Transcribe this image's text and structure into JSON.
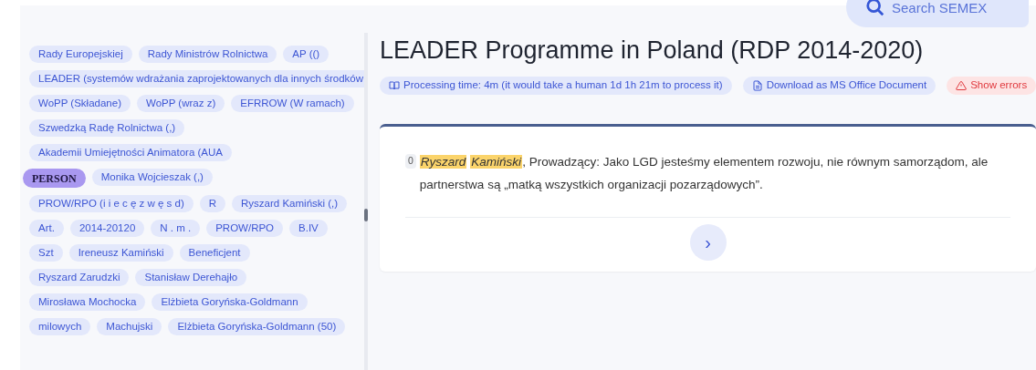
{
  "search": {
    "placeholder": "Search SEMEX"
  },
  "tag_rows": [
    [
      {
        "kind": "tag",
        "text": "Rady Europejskiej"
      },
      {
        "kind": "tag",
        "text": "Rady Ministrów Rolnictwa"
      },
      {
        "kind": "tag",
        "text": "AP (()"
      }
    ],
    [
      {
        "kind": "tag",
        "text": "LEADER (systemów wdrażania zaprojektowanych dla innych środków"
      }
    ],
    [
      {
        "kind": "tag",
        "text": "WoPP (Składane)"
      },
      {
        "kind": "tag",
        "text": "WoPP (wraz z)"
      },
      {
        "kind": "tag",
        "text": "EFRROW (W ramach)"
      }
    ],
    [
      {
        "kind": "tag",
        "text": "Szwedzką Radę Rolnictwa (,)"
      }
    ],
    [
      {
        "kind": "tag",
        "text": "Akademii Umiejętności Animatora (AUA"
      }
    ],
    [
      {
        "kind": "label",
        "text": "PERSON"
      },
      {
        "kind": "tag",
        "text": "Monika Wojcieszak (,)"
      }
    ],
    [
      {
        "kind": "tag",
        "text": "PROW/RPO (i i e c ę z w ę s d)"
      },
      {
        "kind": "tag",
        "text": "R"
      },
      {
        "kind": "tag",
        "text": "Ryszard Kamiński (,)"
      }
    ],
    [
      {
        "kind": "tag",
        "text": "Art."
      },
      {
        "kind": "tag",
        "text": "2014-20120"
      },
      {
        "kind": "tag",
        "text": "N . m ."
      },
      {
        "kind": "tag",
        "text": "PROW/RPO"
      },
      {
        "kind": "tag",
        "text": "B.IV"
      }
    ],
    [
      {
        "kind": "tag",
        "text": "Szt"
      },
      {
        "kind": "tag",
        "text": "Ireneusz Kamiński"
      },
      {
        "kind": "tag",
        "text": "Beneficjent"
      }
    ],
    [
      {
        "kind": "tag",
        "text": "Ryszard Zarudzki"
      },
      {
        "kind": "tag",
        "text": "Stanisław Derehajło"
      }
    ],
    [
      {
        "kind": "tag",
        "text": "Mirosława Mochocka"
      },
      {
        "kind": "tag",
        "text": "Elżbieta Goryńska-Goldmann"
      }
    ],
    [
      {
        "kind": "tag",
        "text": "milowych"
      },
      {
        "kind": "tag",
        "text": "Machujski"
      },
      {
        "kind": "tag",
        "text": "Elżbieta Goryńska-Goldmann (50)"
      }
    ]
  ],
  "title": "LEADER Programme in Poland (RDP 2014-2020)",
  "actions": [
    {
      "kind": "info",
      "text": "Processing time: 4m (it would take a human 1d 1h 21m to process it)"
    },
    {
      "kind": "download",
      "text": "Download as MS Office Document"
    },
    {
      "kind": "error",
      "text": "Show errors"
    }
  ],
  "sentence": {
    "index": "0",
    "parts": [
      {
        "kind": "entity",
        "text": "Ryszard"
      },
      {
        "kind": "entity",
        "text": "Kamiński"
      },
      {
        "kind": "plain",
        "text": ", Prowadzący: Jako LGD jesteśmy elementem rozwoju, nie równym samorządom, ale partnerstwa są „matką wszystkich organizacji pozarządowych”."
      }
    ]
  },
  "next_button": {
    "label": "›"
  }
}
